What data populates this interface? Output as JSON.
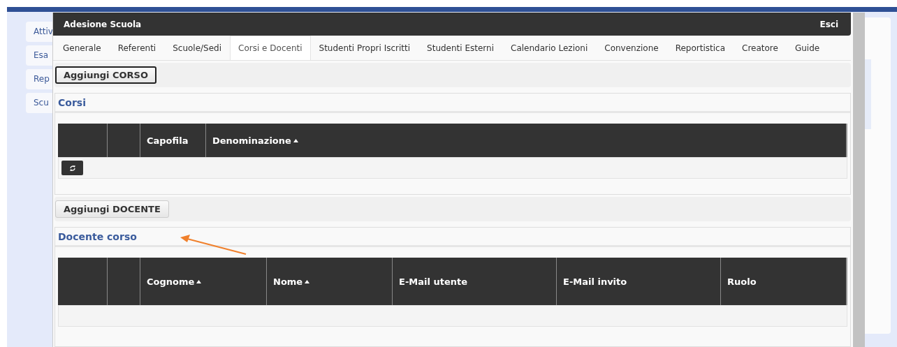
{
  "background_menu": [
    {
      "label": "Attiv"
    },
    {
      "label": "Esa"
    },
    {
      "label": "Rep"
    },
    {
      "label": "Scu"
    }
  ],
  "window": {
    "title": "Adesione Scuola",
    "close_label": "Esci"
  },
  "tabs": [
    {
      "label": "Generale",
      "selected": false
    },
    {
      "label": "Referenti",
      "selected": false
    },
    {
      "label": "Scuole/Sedi",
      "selected": false
    },
    {
      "label": "Corsi e Docenti",
      "selected": true
    },
    {
      "label": "Studenti Propri Iscritti",
      "selected": false
    },
    {
      "label": "Studenti Esterni",
      "selected": false
    },
    {
      "label": "Calendario Lezioni",
      "selected": false
    },
    {
      "label": "Convenzione",
      "selected": false
    },
    {
      "label": "Reportistica",
      "selected": false
    },
    {
      "label": "Creatore",
      "selected": false
    },
    {
      "label": "Guide",
      "selected": false
    }
  ],
  "sections": [
    {
      "button": "Aggiungi CORSO",
      "focused": true,
      "title": "Corsi",
      "refresh_button": true,
      "columns": [
        {
          "label": "Capofila",
          "sorted": false
        },
        {
          "label": "Denominazione",
          "sorted": true
        }
      ]
    },
    {
      "button": "Aggiungi DOCENTE",
      "focused": false,
      "title": "Docente corso",
      "refresh_button": false,
      "columns": [
        {
          "label": "Cognome",
          "sorted": true
        },
        {
          "label": "Nome",
          "sorted": true
        },
        {
          "label": "E-Mail utente",
          "sorted": false
        },
        {
          "label": "E-Mail invito",
          "sorted": false
        },
        {
          "label": "Ruolo",
          "sorted": false
        }
      ]
    }
  ]
}
